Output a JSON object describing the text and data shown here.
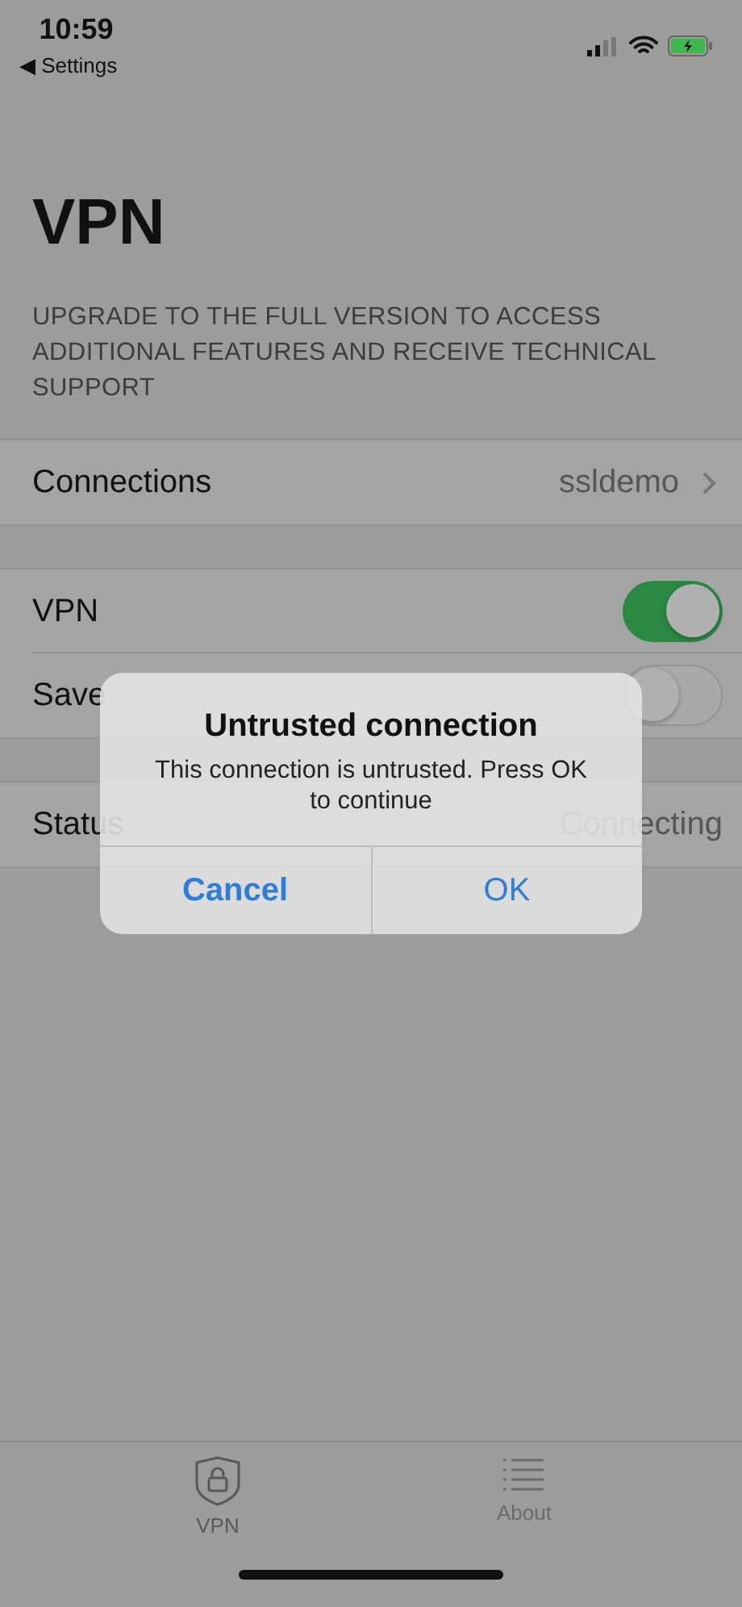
{
  "status_bar": {
    "time": "10:59",
    "back_label": "◀ Settings"
  },
  "title": "VPN",
  "notice": "UPGRADE TO THE FULL VERSION TO ACCESS ADDITIONAL FEATURES AND RECEIVE TECHNICAL SUPPORT",
  "groups": [
    [
      {
        "kind": "link",
        "label": "Connections",
        "value": "ssldemo"
      }
    ],
    [
      {
        "kind": "switch",
        "label": "VPN",
        "on": true
      },
      {
        "kind": "switch",
        "label": "Save",
        "on": false
      }
    ],
    [
      {
        "kind": "value",
        "label": "Status",
        "value": "Connecting"
      }
    ]
  ],
  "alert": {
    "title": "Untrusted connection",
    "message": "This connection is untrusted. Press OK to continue",
    "buttons": [
      "Cancel",
      "OK"
    ]
  },
  "tab_bar": [
    {
      "label": "VPN",
      "selected": true
    },
    {
      "label": "About",
      "selected": false
    }
  ]
}
